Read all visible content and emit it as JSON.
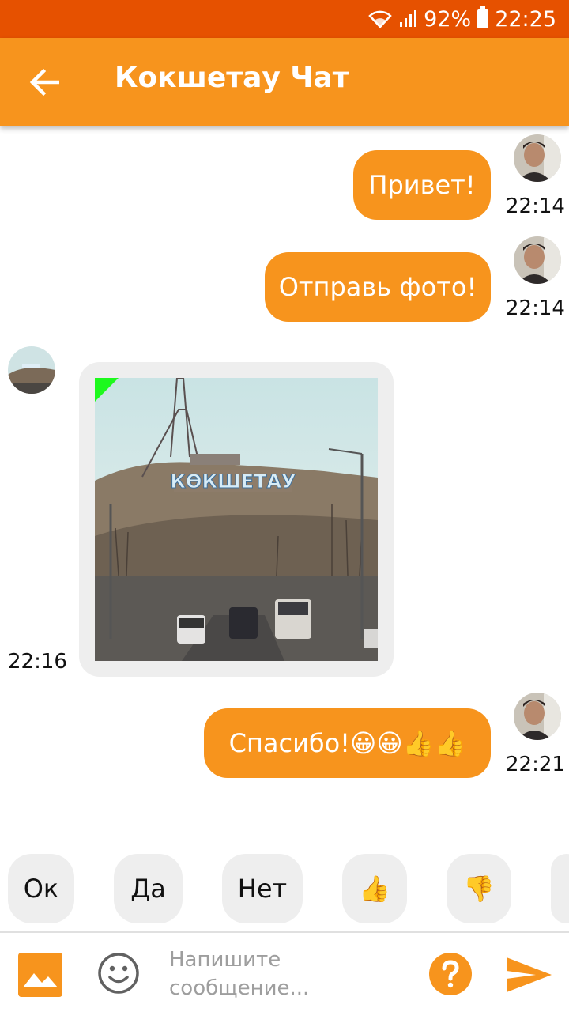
{
  "status_bar": {
    "battery": "92%",
    "time": "22:25"
  },
  "header": {
    "title": "Кокшетау Чат"
  },
  "messages": [
    {
      "text": "Привет!",
      "time": "22:14"
    },
    {
      "text": "Отправь фото!",
      "time": "22:14"
    },
    {
      "sign_text": "КӨКШЕТАУ",
      "time": "22:16"
    },
    {
      "text": "Спасибо!😀😀👍👍",
      "time": "22:21"
    }
  ],
  "quick_replies": [
    "Ок",
    "Да",
    "Нет",
    "👍",
    "👎"
  ],
  "input": {
    "placeholder": "Напишите сообщение..."
  },
  "colors": {
    "accent": "#f7941d",
    "status_bar": "#e65100",
    "chip_bg": "#eeeeee"
  },
  "icons": [
    "back-arrow-icon",
    "wifi-icon",
    "signal-icon",
    "battery-icon",
    "gallery-icon",
    "emoji-icon",
    "help-icon",
    "send-icon"
  ]
}
